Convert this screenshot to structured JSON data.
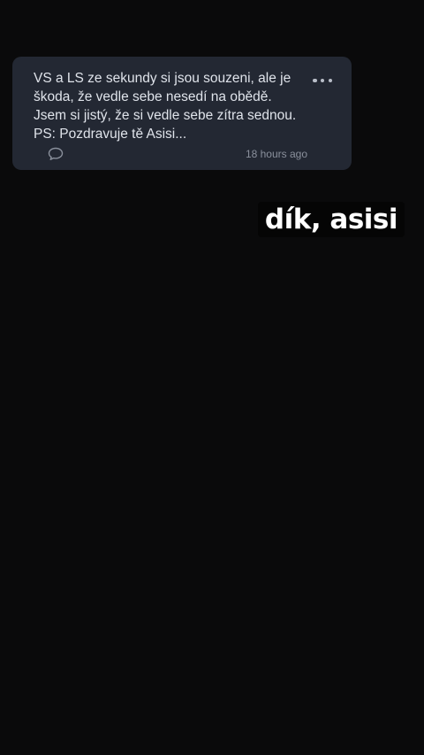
{
  "post": {
    "text": "VS a LS ze sekundy si jsou souzeni, ale je škoda, že vedle sebe nesedí na obědě. Jsem si jistý, že si vedle sebe zítra sednou. PS: Pozdravuje tě Asisi...",
    "timestamp": "18 hours ago",
    "comment_icon": "comment-icon",
    "more_icon": "more-icon"
  },
  "caption": {
    "text": "dík, asisi"
  },
  "colors": {
    "background": "#0a0a0b",
    "card": "#232833",
    "text": "#dfe3ea",
    "muted": "#8a909c"
  }
}
